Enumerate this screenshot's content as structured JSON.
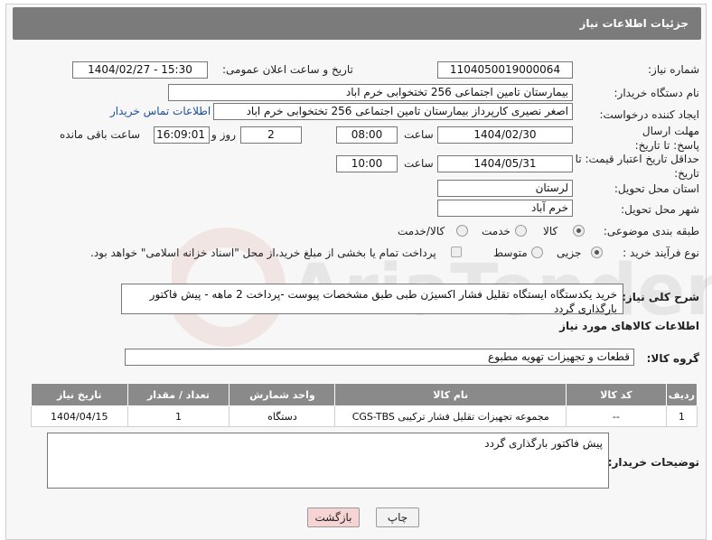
{
  "header": {
    "title": "جزئیات اطلاعات نیاز"
  },
  "form": {
    "need_number_label": "شماره نیاز:",
    "need_number": "1104050019000064",
    "announce_label": "تاریخ و ساعت اعلان عمومی:",
    "announce_value": "1404/02/27 - 15:30",
    "buyer_org_label": "نام دستگاه خریدار:",
    "buyer_org": "بیمارستان تامین اجتماعی  256 تختخوابی خرم اباد",
    "requester_label": "ایجاد کننده درخواست:",
    "requester": "اصغر نصیری کارپرداز بیمارستان تامین اجتماعی  256 تختخوابی خرم اباد",
    "buyer_contact_link": "اطلاعات تماس خریدار",
    "deadline_label": "مهلت ارسال پاسخ: تا تاریخ:",
    "deadline_date": "1404/02/30",
    "time_label": "ساعت",
    "deadline_time": "08:00",
    "days_value": "2",
    "days_label": "روز و",
    "remaining_time": "16:09:01",
    "remaining_label": "ساعت باقی مانده",
    "validity_label": "حداقل تاریخ اعتبار قیمت: تا تاریخ:",
    "validity_date": "1404/05/31",
    "validity_time": "10:00",
    "province_label": "استان محل تحویل:",
    "province": "لرستان",
    "city_label": "شهر محل تحویل:",
    "city": "خرم آباد",
    "category_label": "طبقه بندی موضوعی:",
    "category_options": [
      "کالا",
      "خدمت",
      "کالا/خدمت"
    ],
    "category_selected": "کالا",
    "process_label": "نوع فرآیند خرید :",
    "process_options": [
      "جزیی",
      "متوسط"
    ],
    "process_selected": "جزیی",
    "payment_note": "پرداخت تمام یا بخشی از مبلغ خرید،از محل \"اسناد خزانه اسلامی\" خواهد بود.",
    "description_label": "شرح کلی نیاز:",
    "description": "خرید یکدستگاه ایستگاه تقلیل فشار اکسیژن طبی طبق مشخصات پیوست -پرداخت 2 ماهه - پیش فاکتور بارگذاری گردد"
  },
  "goods": {
    "section_title": "اطلاعات کالاهای مورد نیاز",
    "group_label": "گروه کالا:",
    "group_value": "قطعات و تجهیزات تهویه مطبوع",
    "columns": [
      "ردیف",
      "کد کالا",
      "نام کالا",
      "واحد شمارش",
      "تعداد / مقدار",
      "تاریخ نیاز"
    ],
    "rows": [
      [
        "1",
        "--",
        "مجموعه تجهیزات تقلیل فشار ترکیبی CGS-TBS",
        "دستگاه",
        "1",
        "1404/04/15"
      ]
    ]
  },
  "buyer_notes": {
    "label": "توضیحات خریدار:",
    "text": "پیش فاکتور بارگذاری گردد"
  },
  "buttons": {
    "print": "چاپ",
    "back": "بازگشت"
  },
  "colors": {
    "titlebar": "#7b7b7b",
    "table_header": "#8a8a8a",
    "link": "#1a4fa0",
    "back_button": "#f6d4d4"
  }
}
